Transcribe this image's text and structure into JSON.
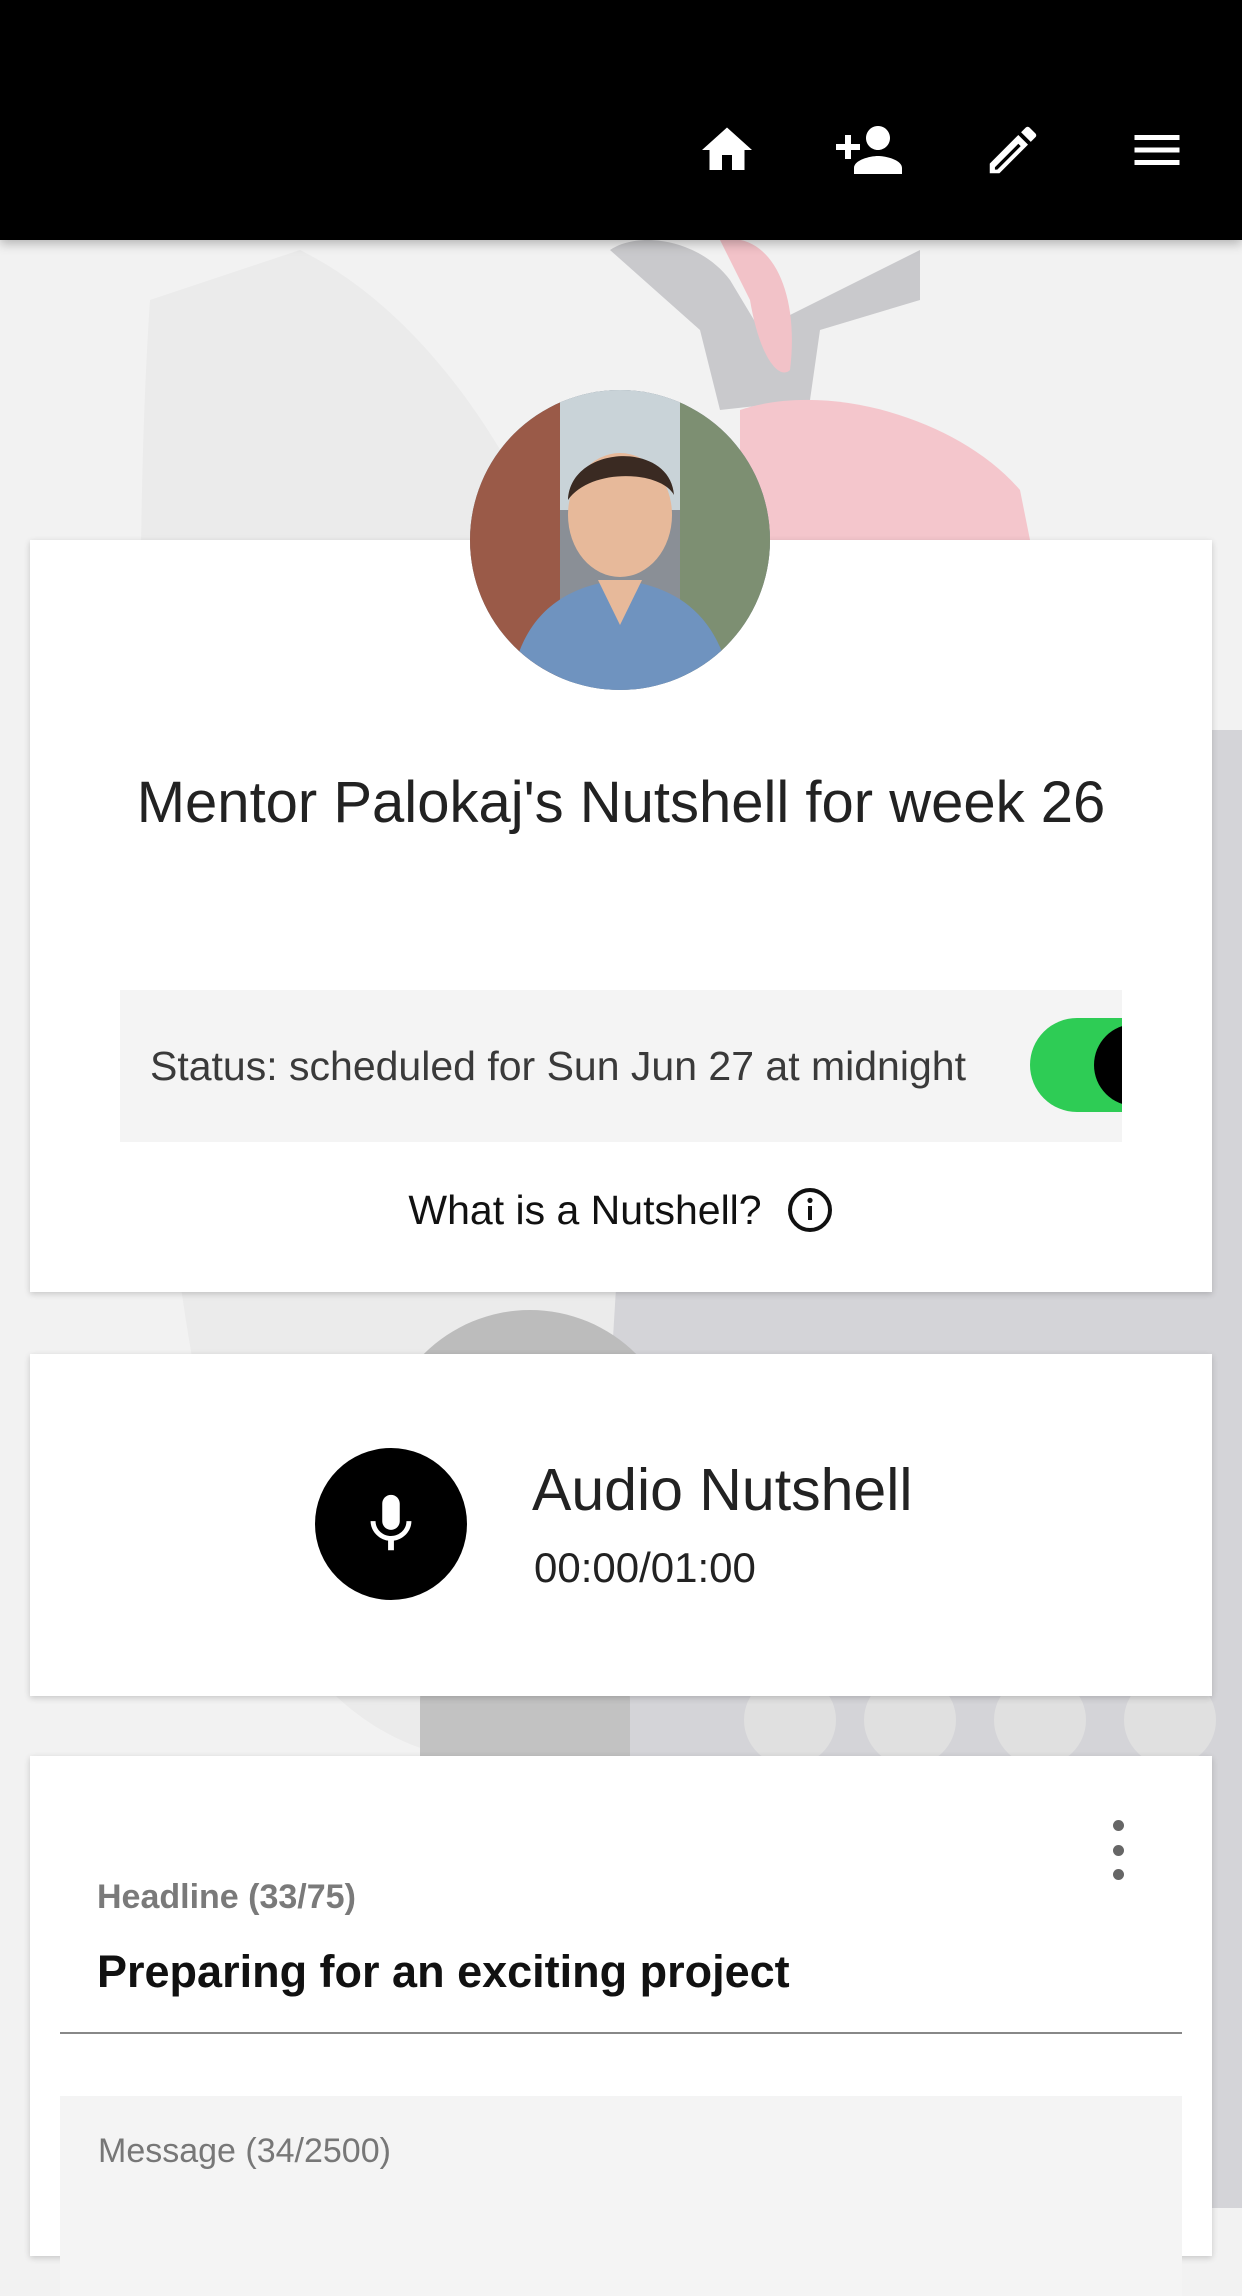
{
  "topbar": {
    "icons": [
      "home-icon",
      "add-person-icon",
      "pencil-icon",
      "hamburger-menu-icon"
    ]
  },
  "profile": {
    "title": "Mentor Palokaj's Nutshell for week 26",
    "status_text": "Status: scheduled for Sun Jun 27 at midnight",
    "toggle_on": true,
    "help_text": "What is a Nutshell?"
  },
  "audio": {
    "title": "Audio Nutshell",
    "time": "00:00/01:00"
  },
  "editor": {
    "headline_label": "Headline (33/75)",
    "headline_value": "Preparing for an exciting project",
    "message_label": "Message (34/2500)"
  },
  "colors": {
    "topbar": "#000000",
    "toggle_on": "#2ecc55",
    "page_bg": "#f2f2f2"
  }
}
